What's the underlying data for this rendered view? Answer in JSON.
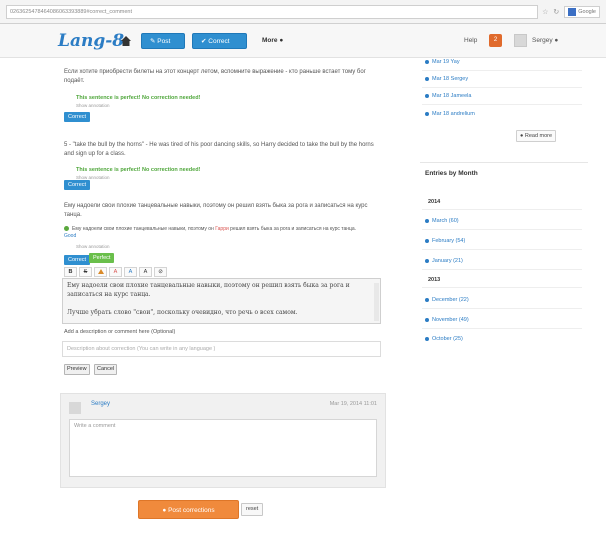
{
  "browser": {
    "url": "0263625478464086063393889#correct_comment",
    "search_label": "Google"
  },
  "header": {
    "logo": "Lang-8",
    "post_label": "Post",
    "correct_label": "Correct",
    "more_label": "More",
    "help_label": "Help",
    "notification_count": "2",
    "user_name": "Sergey"
  },
  "main": {
    "sentence_1_ru": "Если хотите приобрести билеты на этот концерт летом, вспомните выражение - кто раньше встает тому бог подаёт.",
    "perfect_message": "This sentence is perfect! No correction needed!",
    "show_annotation": "Show annotation",
    "sentence_5_en": "5 - \"take the bull by the horns\" - He was tired of his poor dancing skills, so Harry decided to take the bull by the horns and sign up for a class.",
    "correct_label": "Correct",
    "perfect_label": "Perfect",
    "sentence_6_ru": "Ему надоели свои плохие танцевальные навыки, поэтому он решил взять быка за рога и записаться на курс танца.",
    "correction_before": "Ему надоели свои плохие танцевальные навыки, поэтому он",
    "correction_highlight": "Гарри",
    "correction_after": "решил взять быка за рога и записаться на курс танца.",
    "good_label": "Good",
    "format_buttons": [
      "B",
      "S",
      "A",
      "A",
      "A",
      "⊘"
    ],
    "editor_line_1": "Ему надоели свои плохие танцевальные навыки, поэтому он решил взять быка за рога и записаться на курс танца.",
    "editor_line_2": "Лучше убрать слово \"свои\", поскольку очевидно, что речь о всех самом.",
    "description_label": "Add a description or comment here (Optional)",
    "description_placeholder": "Description about correction (You can write in any language )",
    "preview_label": "Preview",
    "cancel_label": "Cancel",
    "comment_user": "Sergey",
    "comment_date": "Mar 19, 2014 11:01",
    "comment_placeholder": "Write a comment",
    "post_corrections_label": "Post corrections",
    "reset_label": "reset"
  },
  "sidebar": {
    "recent": [
      "Mar 19 Yay",
      "Mar 18 Sergey",
      "Mar 18 Jameela",
      "Mar 18 andrelium"
    ],
    "read_more_label": "Read more",
    "entries_title": "Entries by Month",
    "year_2014": "2014",
    "months_2014": [
      "March (60)",
      "February (54)",
      "January (21)"
    ],
    "year_2013": "2013",
    "months_2013": [
      "December (22)",
      "November (49)",
      "October (25)"
    ]
  },
  "colors": {
    "brand_blue": "#2f8fd0",
    "perfect_green": "#4ea63a",
    "post_orange": "#f08a3c"
  }
}
